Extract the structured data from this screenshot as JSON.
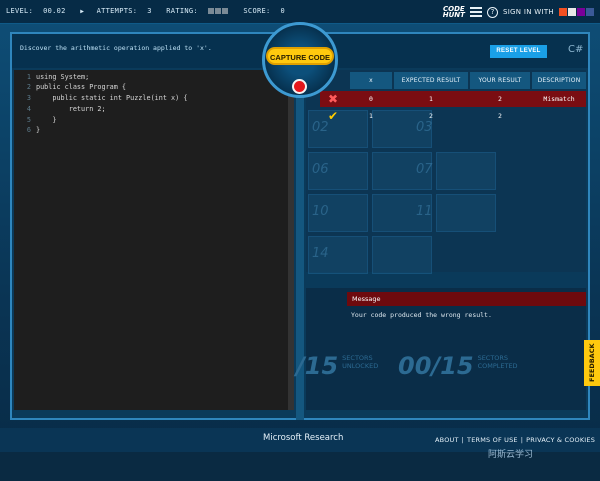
{
  "header": {
    "level_label": "LEVEL:",
    "level_value": "00.02",
    "attempts_label": "ATTEMPTS:",
    "attempts_value": "3",
    "rating_label": "RATING:",
    "score_label": "SCORE:",
    "score_value": "0",
    "logo_line1": "CODE",
    "logo_line2": "HUNT",
    "signin_label": "SIGN IN WITH",
    "social_colors": [
      "#f25022",
      "#0078d7",
      "#ffb900",
      "#3b5998"
    ]
  },
  "instruction": "Discover the arithmetic operation applied to 'x'.",
  "reset_label": "RESET LEVEL",
  "language": "C#",
  "capture_label": "CAPTURE CODE",
  "code": [
    {
      "n": "1",
      "text": "using System;"
    },
    {
      "n": "2",
      "text": "public class Program {"
    },
    {
      "n": "3",
      "text": "    public static int Puzzle(int x) {"
    },
    {
      "n": "4",
      "text": "        return 2;"
    },
    {
      "n": "5",
      "text": "    }"
    },
    {
      "n": "6",
      "text": "}"
    }
  ],
  "table": {
    "headers": [
      "x",
      "EXPECTED RESULT",
      "YOUR RESULT",
      "DESCRIPTION"
    ],
    "rows": [
      {
        "status": "fail",
        "x": "0",
        "expected": "1",
        "yours": "2",
        "desc": "Mismatch"
      },
      {
        "status": "pass",
        "x": "1",
        "expected": "2",
        "yours": "2",
        "desc": ""
      }
    ]
  },
  "tiles": [
    "02",
    "03",
    "06",
    "07",
    "10",
    "11",
    "14"
  ],
  "message": {
    "title": "Message",
    "body": "Your code produced the wrong result."
  },
  "sectors": {
    "unlocked_count": "/15",
    "unlocked_line1": "SECTORS",
    "unlocked_line2": "UNLOCKED",
    "completed_count": "00/15",
    "completed_line1": "SECTORS",
    "completed_line2": "COMPLETED"
  },
  "feedback_label": "FEEDBACK",
  "footer": {
    "brand": "Microsoft Research",
    "about": "ABOUT",
    "terms": "TERMS OF USE",
    "privacy": "PRIVACY & COOKIES"
  },
  "watermark": "阿斯云学习"
}
